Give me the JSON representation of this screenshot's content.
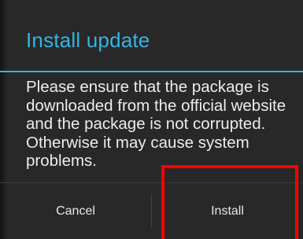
{
  "dialog": {
    "title": "Install update",
    "message": "Please ensure that the package is downloaded from the official website and the package is not corrupted. Otherwise it may cause system problems.",
    "buttons": {
      "cancel_label": "Cancel",
      "install_label": "Install"
    }
  },
  "colors": {
    "accent": "#33b5e5",
    "dialog_background": "#282828",
    "highlight_box": "#ff0000"
  }
}
